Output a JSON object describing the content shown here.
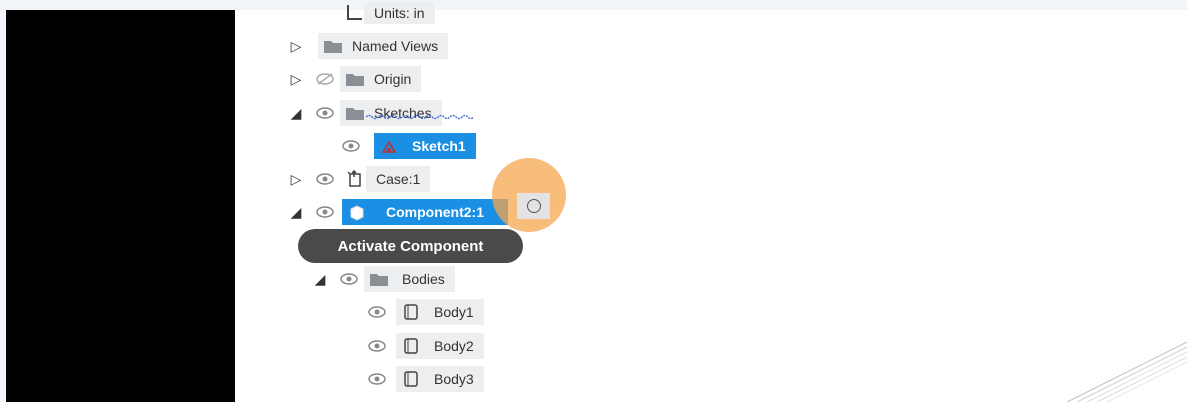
{
  "tree": {
    "units": {
      "label": "Units: in"
    },
    "named_views": {
      "label": "Named Views"
    },
    "origin": {
      "label": "Origin"
    },
    "sketches": {
      "label": "Sketches"
    },
    "sketch1": {
      "label": "Sketch1"
    },
    "case1": {
      "label": "Case:1"
    },
    "component2": {
      "label": "Component2:1"
    },
    "bodies": {
      "label": "Bodies"
    },
    "body1": {
      "label": "Body1"
    },
    "body2": {
      "label": "Body2"
    },
    "body3": {
      "label": "Body3"
    }
  },
  "tooltip": {
    "text": "Activate Component"
  },
  "colors": {
    "selected": "#1a8fe3",
    "halo": "#f5a64f",
    "tooltip": "#4a4a4a"
  }
}
